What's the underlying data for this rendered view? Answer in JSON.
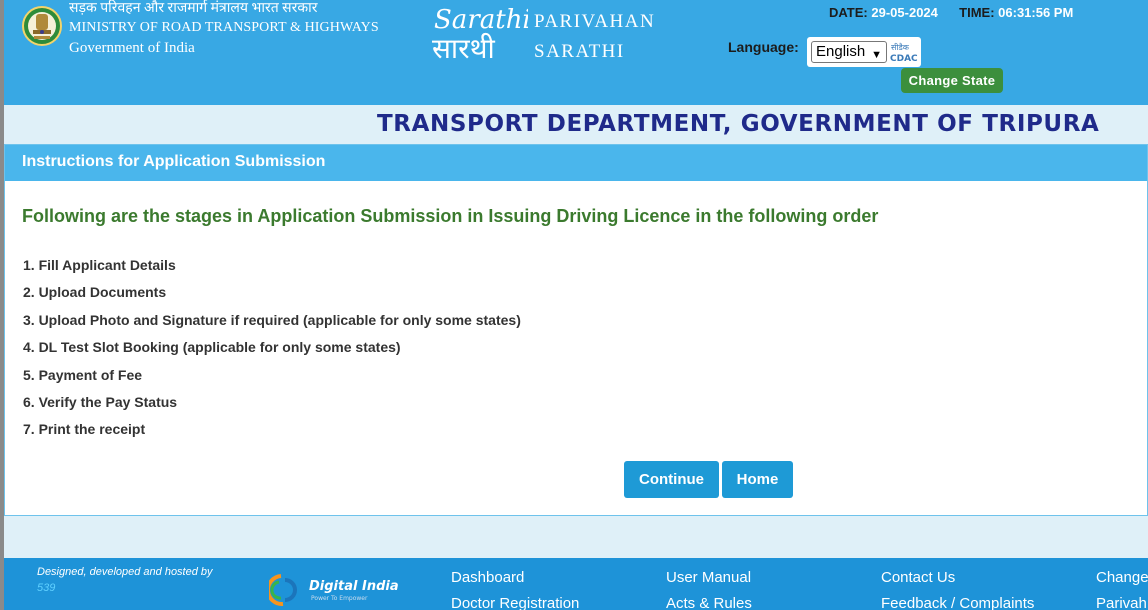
{
  "header": {
    "ministry_hindi": "सड़क परिवहन और राजमार्ग मंत्रालय भारत सरकार",
    "ministry_english": "MINISTRY OF ROAD TRANSPORT & HIGHWAYS",
    "government": "Government of India",
    "brand_line1": "PARIVAHAN",
    "brand_line2": "SARATHI",
    "sarathi_logo_text": "Sarathi",
    "sarathi_logo_hindi": "सारथी",
    "date_label": "DATE:",
    "date_value": "29-05-2024",
    "time_label": "TIME:",
    "time_value": "06:31:56 PM",
    "language_label": "Language:",
    "language_selected": "English",
    "cdac_logo_text": "सीडैक",
    "change_state_label": "Change State"
  },
  "title": "TRANSPORT DEPARTMENT, GOVERNMENT OF TRIPURA",
  "panel": {
    "header": "Instructions for Application Submission",
    "heading": "Following are the stages in Application Submission in Issuing Driving Licence in the following order",
    "steps": [
      "1. Fill Applicant Details",
      "2. Upload Documents",
      "3. Upload Photo and Signature if required (applicable for only some states)",
      "4. DL Test Slot Booking (applicable for only some states)",
      "5. Payment of Fee",
      "6. Verify the Pay Status",
      "7. Print the receipt"
    ],
    "continue_label": "Continue",
    "home_label": "Home"
  },
  "footer": {
    "designed_text": "Designed, developed and hosted by",
    "designed_by": "539",
    "digital_india": "Digital India",
    "digital_india_tagline": "Power To Empower",
    "links": [
      "Dashboard",
      "User Manual",
      "Contact Us",
      "Change",
      "Doctor Registration",
      "Acts & Rules",
      "Feedback / Complaints",
      "Parivah"
    ]
  },
  "colors": {
    "header_bg": "#38a8e4",
    "panel_header_bg": "#4ab6ec",
    "title_color": "#1f2a8a",
    "heading_color": "#3b7a2e",
    "button_bg": "#1e9ad6",
    "change_state_bg": "#3c8f3d",
    "footer_bg": "#1e93d8"
  }
}
